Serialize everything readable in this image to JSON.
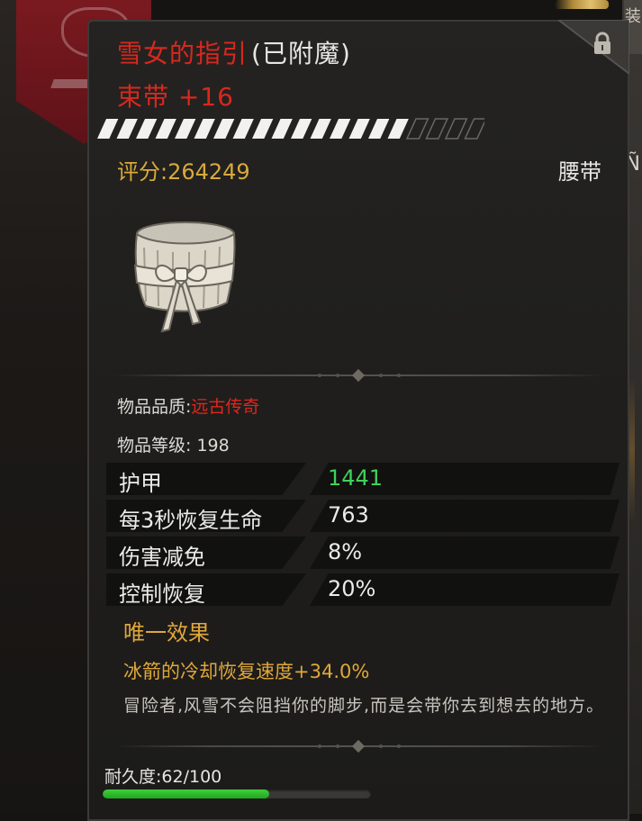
{
  "background": {
    "right_tab_glyph": "装",
    "right_fragment_glyph": "Ñ"
  },
  "item": {
    "name": "雪女的指引",
    "enchant_suffix": "(已附魔)",
    "subtitle": "束带 +16",
    "score_label": "评分:264249",
    "slot_type": "腰带",
    "icon": "belt-sash-icon",
    "upgrade_stripes_filled": 16,
    "upgrade_stripes_total": 20,
    "locked": true
  },
  "info": {
    "quality_label": "物品品质:",
    "quality_value": "远古传奇",
    "level_label": "物品等级: 198"
  },
  "stats": [
    {
      "label": "护甲",
      "value": "1441",
      "color": "#3fd25a"
    },
    {
      "label": "每3秒恢复生命",
      "value": "763",
      "color": "#ecebe8"
    },
    {
      "label": "伤害减免",
      "value": "8%",
      "color": "#ecebe8"
    },
    {
      "label": "控制恢复",
      "value": "20%",
      "color": "#ecebe8"
    }
  ],
  "unique": {
    "title": "唯一效果",
    "effect": "冰箭的冷却恢复速度+34.0%"
  },
  "flavor_text": "冒险者,风雪不会阻挡你的脚步,而是会带你去到想去的地方。",
  "durability": {
    "label": "耐久度:62/100",
    "current": 62,
    "max": 100
  },
  "colors": {
    "legendary_red": "#d8281e",
    "gold": "#d9a93c",
    "stat_green": "#3fd25a",
    "durability_green": "#3fcf3a"
  }
}
